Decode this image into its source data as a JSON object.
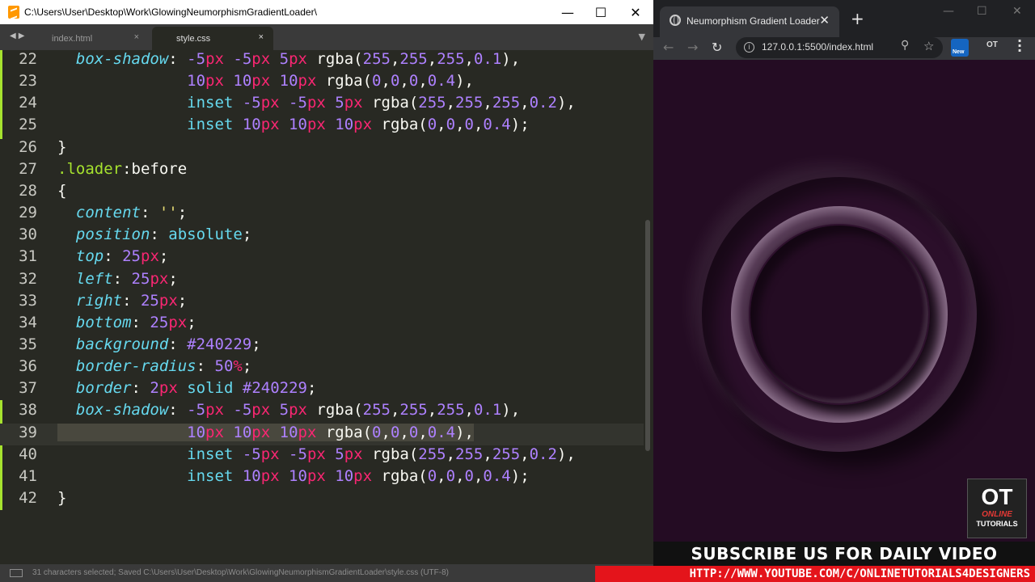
{
  "editor": {
    "title_path": "C:\\Users\\User\\Desktop\\Work\\GlowingNeumorphismGradientLoader\\",
    "tabs": [
      {
        "label": "index.html",
        "close": "×",
        "active": false
      },
      {
        "label": "style.css",
        "close": "×",
        "active": true
      }
    ],
    "window_controls": {
      "minimize": "—",
      "maximize": "☐",
      "close": "✕"
    },
    "statusbar_text": "31 characters selected; Saved C:\\Users\\User\\Desktop\\Work\\GlowingNeumorphismGradientLoader\\style.css (UTF-8)",
    "code_lines": [
      {
        "num": "22",
        "text": "  box-shadow: -5px -5px 5px rgba(255,255,255,0.1),"
      },
      {
        "num": "23",
        "text": "              10px 10px 10px rgba(0,0,0,0.4),"
      },
      {
        "num": "24",
        "text": "              inset -5px -5px 5px rgba(255,255,255,0.2),"
      },
      {
        "num": "25",
        "text": "              inset 10px 10px 10px rgba(0,0,0,0.4);"
      },
      {
        "num": "26",
        "text": "}"
      },
      {
        "num": "27",
        "text": ".loader:before"
      },
      {
        "num": "28",
        "text": "{"
      },
      {
        "num": "29",
        "text": "  content: '';"
      },
      {
        "num": "30",
        "text": "  position: absolute;"
      },
      {
        "num": "31",
        "text": "  top: 25px;"
      },
      {
        "num": "32",
        "text": "  left: 25px;"
      },
      {
        "num": "33",
        "text": "  right: 25px;"
      },
      {
        "num": "34",
        "text": "  bottom: 25px;"
      },
      {
        "num": "35",
        "text": "  background: #240229;"
      },
      {
        "num": "36",
        "text": "  border-radius: 50%;"
      },
      {
        "num": "37",
        "text": "  border: 2px solid #240229;"
      },
      {
        "num": "38",
        "text": "  box-shadow: -5px -5px 5px rgba(255,255,255,0.1),"
      },
      {
        "num": "39",
        "text": "              10px 10px 10px rgba(0,0,0,0.4),"
      },
      {
        "num": "40",
        "text": "              inset -5px -5px 5px rgba(255,255,255,0.2),"
      },
      {
        "num": "41",
        "text": "              inset 10px 10px 10px rgba(0,0,0,0.4);"
      },
      {
        "num": "42",
        "text": "}"
      }
    ],
    "current_line": "39"
  },
  "browser": {
    "tab_title": "Neumorphism Gradient Loader",
    "tab_close": "✕",
    "new_tab": "+",
    "url": "127.0.0.1:5500/index.html",
    "ext_new_label": "New",
    "ext_ot_label": "OT",
    "window_controls": {
      "minimize": "—",
      "maximize": "☐",
      "close": "✕"
    }
  },
  "overlay": {
    "logo_big": "OT",
    "logo_mid": "ONLINE",
    "logo_small": "TUTORIALS",
    "subscribe_text": "SUBSCRIBE US FOR DAILY VIDEO",
    "channel_url": "HTTP://WWW.YOUTUBE.COM/C/ONLINETUTORIALS4DESIGNERS"
  },
  "colors": {
    "editor_bg": "#282923",
    "loader_bg": "#240229",
    "property": "#66d9ef",
    "number": "#ae81ff",
    "unit": "#f92672",
    "selector": "#a6e22e",
    "banner_red": "#e4141b"
  },
  "icons": {
    "editor_app": "sublime-text-icon",
    "browser_tab": "globe-icon",
    "back": "arrow-left-icon",
    "forward": "arrow-right-icon",
    "reload": "reload-icon",
    "info": "info-icon",
    "zoom": "zoom-icon",
    "bookmark": "star-icon",
    "menu": "kebab-menu-icon"
  }
}
